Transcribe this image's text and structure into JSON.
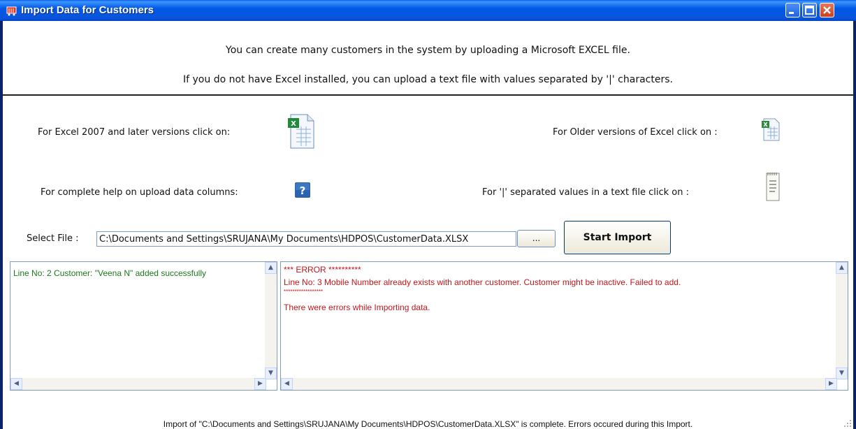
{
  "window": {
    "title": "Import Data for Customers",
    "accent": "#0058e5"
  },
  "header": {
    "line1": "You can create many customers in the system by uploading a Microsoft EXCEL  file.",
    "line2": "If you do not have Excel installed, you can upload a text file with values separated by '|' characters."
  },
  "options": {
    "excel2007_label": "For Excel 2007 and later versions click on:",
    "excel_older_label": "For Older versions of Excel click on :",
    "help_label": "For complete help on upload data columns:",
    "text_label": "For '|' separated  values in a text file click on :",
    "icons": [
      "excel-2007-icon",
      "excel-older-icon",
      "help-icon",
      "text-file-icon"
    ]
  },
  "file": {
    "label": "Select File :",
    "value": "C:\\Documents and Settings\\SRUJANA\\My Documents\\HDPOS\\CustomerData.XLSX",
    "browse_label": "...",
    "start_label": "Start Import"
  },
  "success_log": {
    "lines": [
      "Line No: 2 Customer: \"Veena N\" added successfully"
    ],
    "color": "#1b7a1b"
  },
  "error_log": {
    "header": "*** ERROR **********",
    "line": "Line No: 3  Mobile Number already exists with another customer. Customer might be inactive. Failed to add.",
    "stars": "******************",
    "summary": "There were errors while Importing data.",
    "color": "#c4161c"
  },
  "status": {
    "text": "Import of \"C:\\Documents and Settings\\SRUJANA\\My Documents\\HDPOS\\CustomerData.XLSX\" is complete. Errors occured during this Import."
  }
}
